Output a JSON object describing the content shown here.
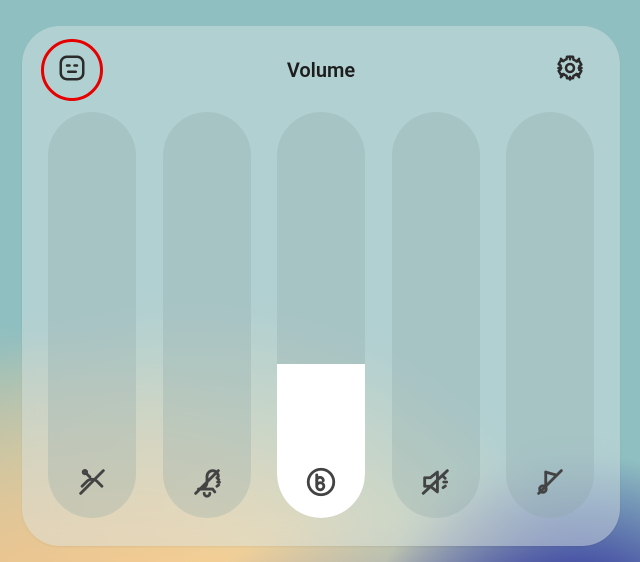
{
  "header": {
    "title": "Volume",
    "collapse_icon": "collapse-panel-icon",
    "settings_icon": "settings-gear-icon"
  },
  "accent_color": "#e60000",
  "sliders": [
    {
      "id": "ringtone",
      "icon": "ringtone-mute-icon",
      "level": 0
    },
    {
      "id": "notification",
      "icon": "notification-mute-icon",
      "level": 0
    },
    {
      "id": "bixby",
      "icon": "bixby-icon",
      "level": 38
    },
    {
      "id": "media",
      "icon": "media-mute-icon",
      "level": 0
    },
    {
      "id": "system",
      "icon": "system-mute-icon",
      "level": 0
    }
  ]
}
